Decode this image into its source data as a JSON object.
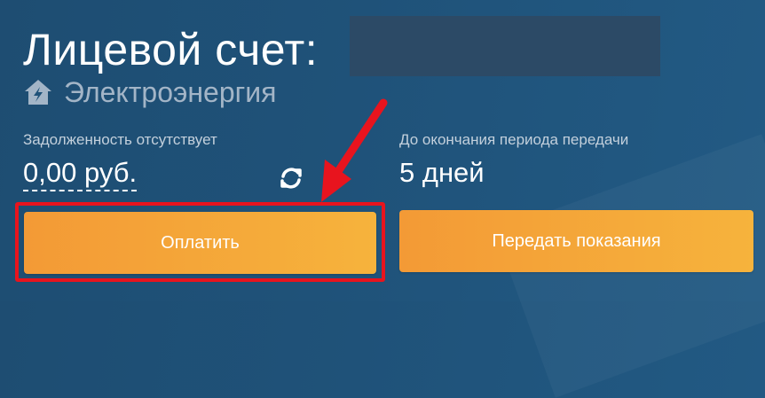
{
  "account": {
    "title": "Лицевой счет:",
    "service_icon": "house-lightning-icon",
    "service_label": "Электроэнергия"
  },
  "debt": {
    "label": "Задолженность отсутствует",
    "value": "0,00 руб."
  },
  "refresh_icon": "refresh-icon",
  "period": {
    "label": "До окончания периода передачи",
    "value": "5 дней"
  },
  "buttons": {
    "pay": "Оплатить",
    "submit_readings": "Передать показания"
  },
  "colors": {
    "background": "#1f5279",
    "button_gradient_start": "#f39a36",
    "button_gradient_end": "#f6b33c",
    "annotation_red": "#e8141e"
  }
}
